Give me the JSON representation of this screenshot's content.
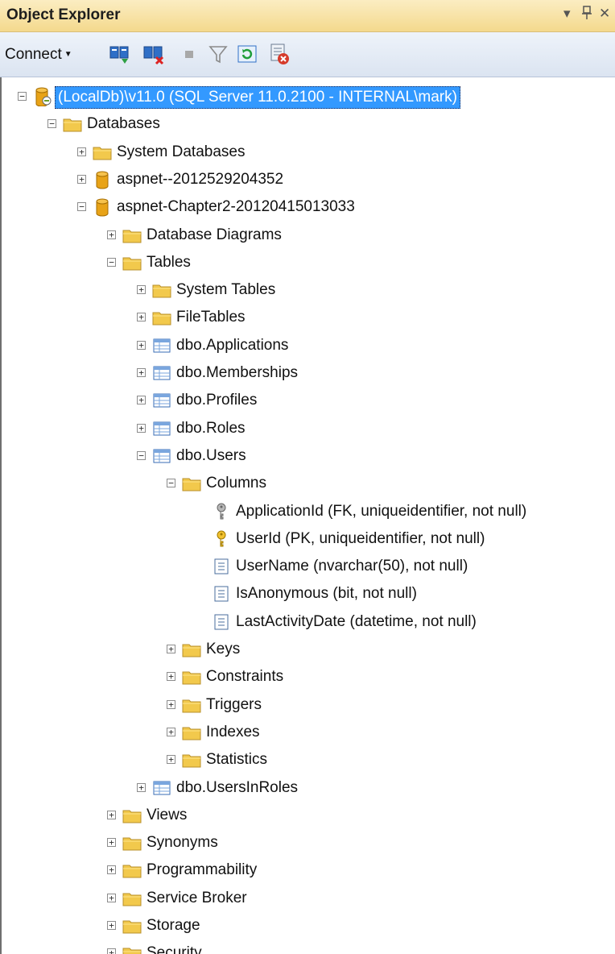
{
  "panel": {
    "title": "Object Explorer",
    "pin_glyph": "9!",
    "dropdown_glyph": "▾",
    "pin_icon": "pin-icon",
    "close_icon": "close-icon"
  },
  "toolbar": {
    "connect_label": "Connect",
    "icons": [
      "connect-object-explorer-icon",
      "disconnect-icon",
      "stop-icon",
      "filter-icon",
      "refresh-icon",
      "activity-monitor-icon"
    ]
  },
  "tree": [
    {
      "label": "(LocalDb)\\v11.0 (SQL Server 11.0.2100 - INTERNAL\\mark)",
      "icon": "server-icon",
      "level": 0,
      "expander": "minus",
      "selected": true
    },
    {
      "label": "Databases",
      "icon": "folder-icon",
      "level": 1,
      "expander": "minus"
    },
    {
      "label": "System Databases",
      "icon": "folder-icon",
      "level": 2,
      "expander": "plus"
    },
    {
      "label": "aspnet--2012529204352",
      "icon": "database-icon",
      "level": 2,
      "expander": "plus"
    },
    {
      "label": "aspnet-Chapter2-20120415013033",
      "icon": "database-icon",
      "level": 2,
      "expander": "minus"
    },
    {
      "label": "Database Diagrams",
      "icon": "folder-icon",
      "level": 3,
      "expander": "plus"
    },
    {
      "label": "Tables",
      "icon": "folder-icon",
      "level": 3,
      "expander": "minus"
    },
    {
      "label": "System Tables",
      "icon": "folder-icon",
      "level": 4,
      "expander": "plus"
    },
    {
      "label": "FileTables",
      "icon": "folder-icon",
      "level": 4,
      "expander": "plus"
    },
    {
      "label": "dbo.Applications",
      "icon": "table-icon",
      "level": 4,
      "expander": "plus"
    },
    {
      "label": "dbo.Memberships",
      "icon": "table-icon",
      "level": 4,
      "expander": "plus"
    },
    {
      "label": "dbo.Profiles",
      "icon": "table-icon",
      "level": 4,
      "expander": "plus"
    },
    {
      "label": "dbo.Roles",
      "icon": "table-icon",
      "level": 4,
      "expander": "plus"
    },
    {
      "label": "dbo.Users",
      "icon": "table-icon",
      "level": 4,
      "expander": "minus"
    },
    {
      "label": "Columns",
      "icon": "folder-icon",
      "level": 5,
      "expander": "minus"
    },
    {
      "label": "ApplicationId (FK, uniqueidentifier, not null)",
      "icon": "foreign-key-icon",
      "level": 6,
      "expander": "none"
    },
    {
      "label": "UserId (PK, uniqueidentifier, not null)",
      "icon": "primary-key-icon",
      "level": 6,
      "expander": "none"
    },
    {
      "label": "UserName (nvarchar(50), not null)",
      "icon": "column-icon",
      "level": 6,
      "expander": "none"
    },
    {
      "label": "IsAnonymous (bit, not null)",
      "icon": "column-icon",
      "level": 6,
      "expander": "none"
    },
    {
      "label": "LastActivityDate (datetime, not null)",
      "icon": "column-icon",
      "level": 6,
      "expander": "none"
    },
    {
      "label": "Keys",
      "icon": "folder-icon",
      "level": 5,
      "expander": "plus"
    },
    {
      "label": "Constraints",
      "icon": "folder-icon",
      "level": 5,
      "expander": "plus"
    },
    {
      "label": "Triggers",
      "icon": "folder-icon",
      "level": 5,
      "expander": "plus"
    },
    {
      "label": "Indexes",
      "icon": "folder-icon",
      "level": 5,
      "expander": "plus"
    },
    {
      "label": "Statistics",
      "icon": "folder-icon",
      "level": 5,
      "expander": "plus"
    },
    {
      "label": "dbo.UsersInRoles",
      "icon": "table-icon",
      "level": 4,
      "expander": "plus"
    },
    {
      "label": "Views",
      "icon": "folder-icon",
      "level": 3,
      "expander": "plus"
    },
    {
      "label": "Synonyms",
      "icon": "folder-icon",
      "level": 3,
      "expander": "plus"
    },
    {
      "label": "Programmability",
      "icon": "folder-icon",
      "level": 3,
      "expander": "plus"
    },
    {
      "label": "Service Broker",
      "icon": "folder-icon",
      "level": 3,
      "expander": "plus"
    },
    {
      "label": "Storage",
      "icon": "folder-icon",
      "level": 3,
      "expander": "plus"
    },
    {
      "label": "Security",
      "icon": "folder-icon",
      "level": 3,
      "expander": "plus"
    }
  ],
  "colors": {
    "selection": "#3399ff",
    "folder": "#f2c94c",
    "database": "#e8a317",
    "title_bar": "#f6df9c"
  }
}
